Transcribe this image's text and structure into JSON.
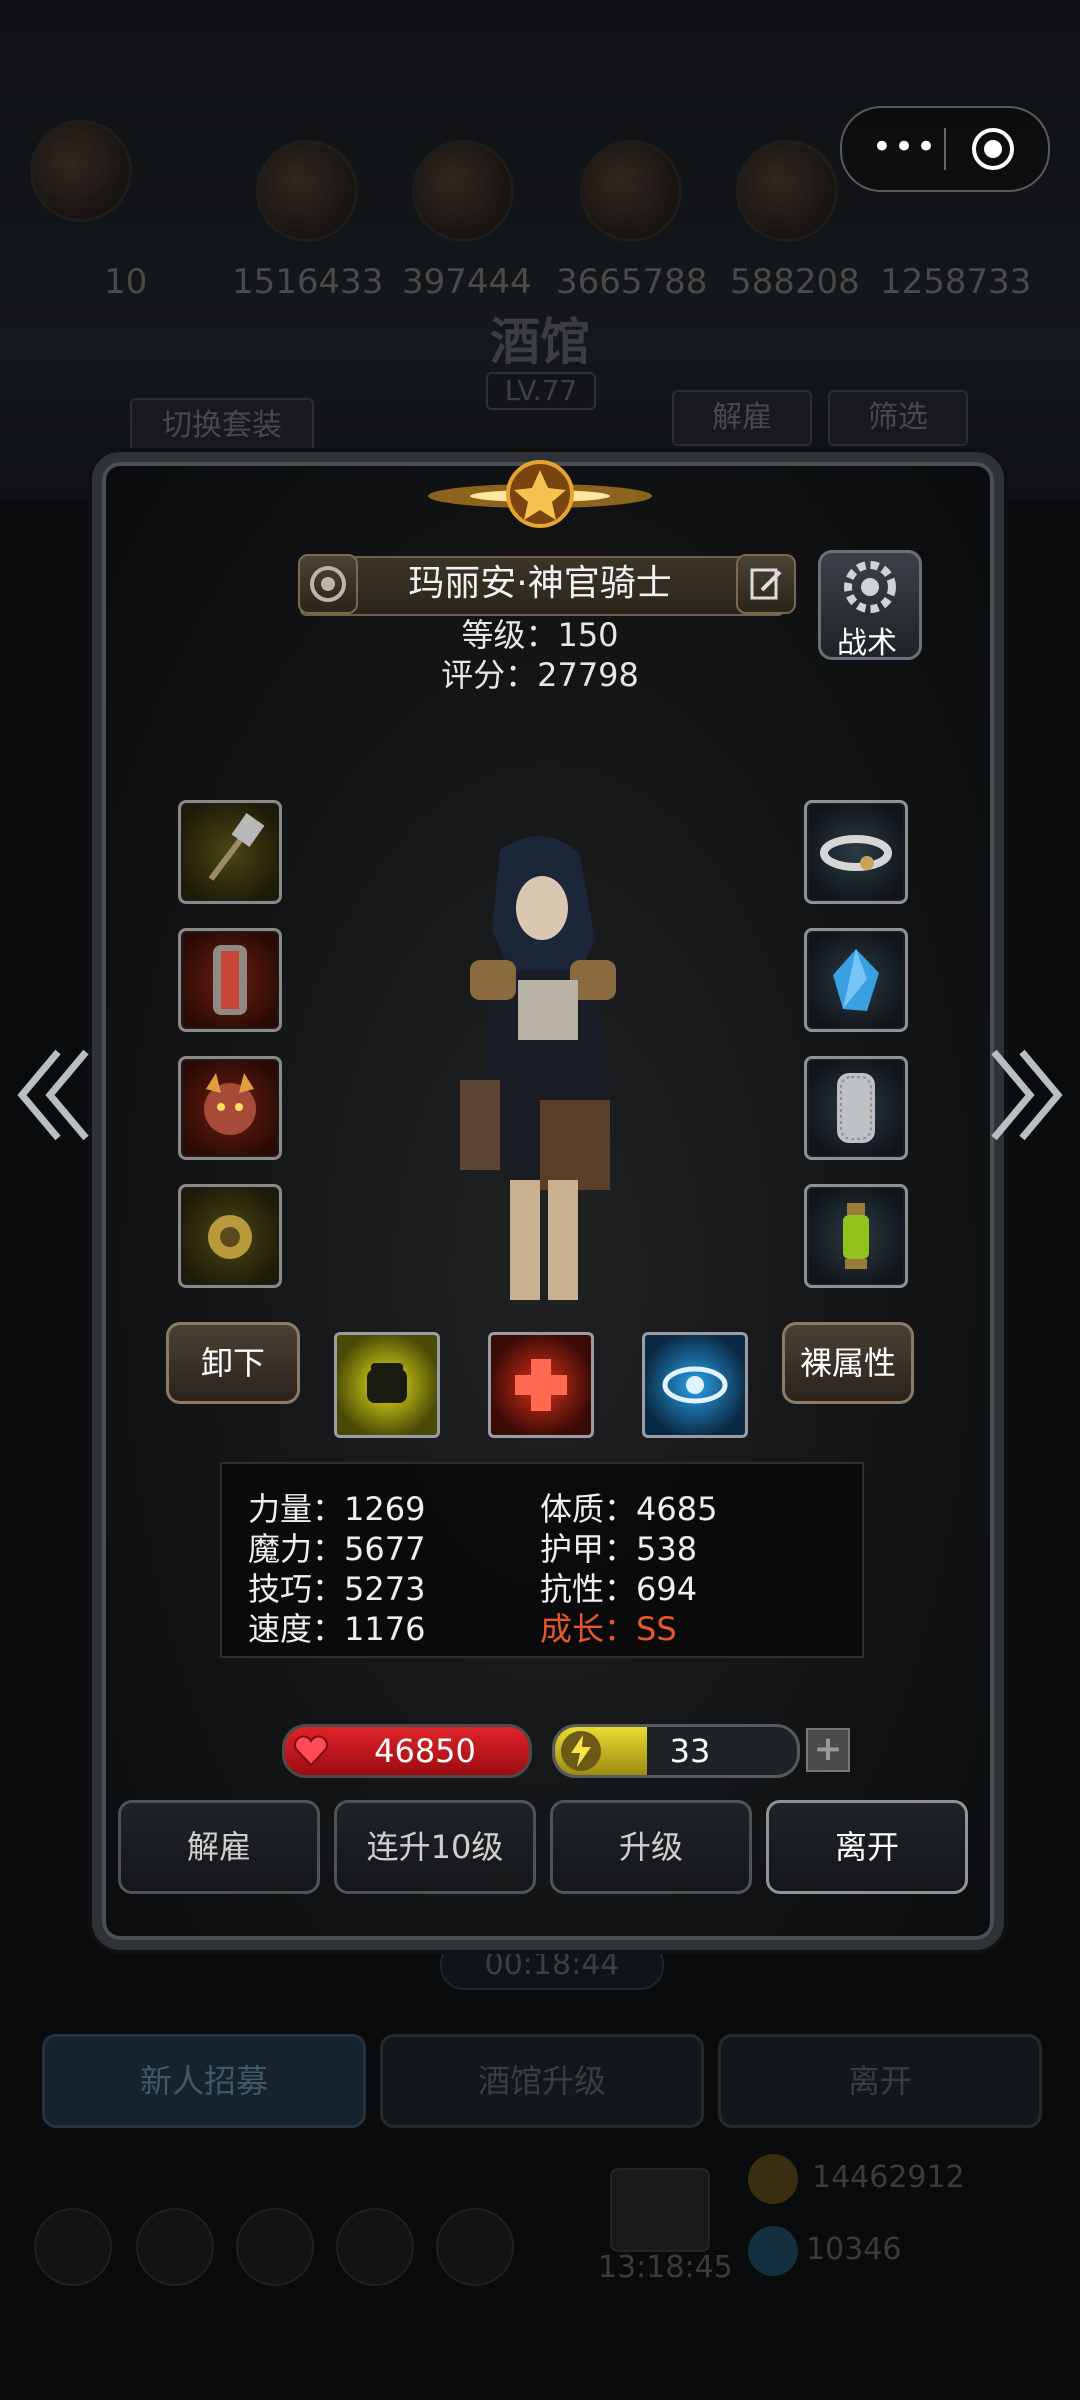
{
  "capsule": {
    "more_label": "•••",
    "close_icon": "target-icon"
  },
  "background": {
    "resources": [
      "10",
      "1516433",
      "397444",
      "3665788",
      "588208",
      "1258733"
    ],
    "title": "酒馆",
    "level": "LV.77",
    "switch_outfit": "切换套装",
    "dismiss": "解雇",
    "filter": "筛选",
    "timer": "00:18:44",
    "bottom_buttons": [
      "新人招募",
      "酒馆升级",
      "离开"
    ],
    "bottom_time": "13:18:45",
    "gold": "14462912",
    "gems": "10346"
  },
  "hero": {
    "name": "玛丽安·神官骑士",
    "level_line": "等级：150",
    "score_line": "评分：27798",
    "tactics_label": "战术"
  },
  "equipment": {
    "left": [
      {
        "name": "mace-icon",
        "frame": "gold"
      },
      {
        "name": "armor-icon",
        "frame": "red"
      },
      {
        "name": "demon-mask-icon",
        "frame": "red"
      },
      {
        "name": "amulet-icon",
        "frame": "gold"
      }
    ],
    "right": [
      {
        "name": "cloud-ring-icon",
        "frame": "blue"
      },
      {
        "name": "crystal-icon",
        "frame": "blue"
      },
      {
        "name": "chainmail-icon",
        "frame": "blue"
      },
      {
        "name": "lantern-icon",
        "frame": "blue"
      }
    ]
  },
  "actions": {
    "unequip": "卸下",
    "bare_attributes": "裸属性",
    "skills": [
      "fist-icon",
      "heal-cross-icon",
      "eye-icon"
    ]
  },
  "stats": {
    "strength": "力量：1269",
    "constitution": "体质：4685",
    "magic": "魔力：5677",
    "armor": "护甲：538",
    "skill": "技巧：5273",
    "resistance": "抗性：694",
    "speed": "速度：1176",
    "growth": "成长：SS",
    "growth_color": "#e8572a"
  },
  "bars": {
    "hp": "46850",
    "energy": "33",
    "energy_fill_fraction": 0.38,
    "add_label": "+"
  },
  "panel_buttons": [
    "解雇",
    "连升10级",
    "升级",
    "离开"
  ]
}
